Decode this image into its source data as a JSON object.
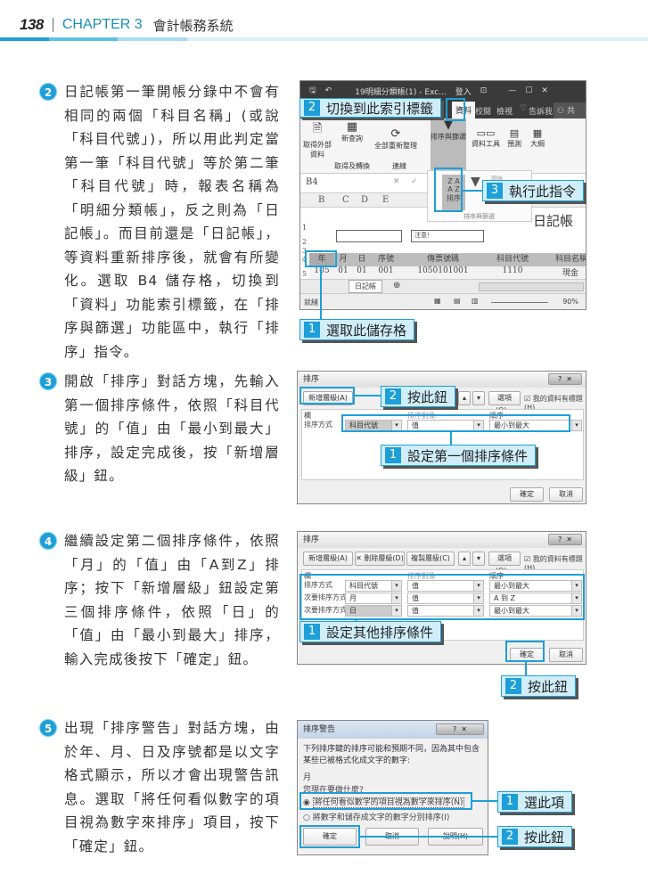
{
  "header": {
    "page_number": "138",
    "chapter": "CHAPTER 3",
    "chapter_title": "會計帳務系統"
  },
  "steps": [
    {
      "num": "2",
      "text": "日記帳第一筆開帳分錄中不會有相同的兩個「科目名稱」(或說「科目代號」)，所以用此判定當第一筆「科目代號」等於第二筆「科目代號」時，報表名稱為「明細分類帳」，反之則為「日記帳」。而目前還是「日記帳」，等資料重新排序後，就會有所變化。選取 B4 儲存格，切換到「資料」功能索引標籤，在「排序與篩選」功能區中，執行「排序」指令。"
    },
    {
      "num": "3",
      "text": "開啟「排序」對話方塊，先輸入第一個排序條件，依照「科目代號」的「值」由「最小到最大」排序，設定完成後，按「新增層級」鈕。"
    },
    {
      "num": "4",
      "text": "繼續設定第二個排序條件，依照「月」的「值」由「A到Z」排序；按下「新增層級」鈕設定第三個排序條件，依照「日」的「值」由「最小到最大」排序，輸入完成後按下「確定」鈕。"
    },
    {
      "num": "5",
      "text": "出現「排序警告」對話方塊，由於年、月、日及序號都是以文字格式顯示，所以才會出現警告訊息。選取「將任何看似數字的項目視為數字來排序」項目，按下「確定」鈕。"
    }
  ],
  "excel": {
    "window_title": "19明細分類帳(1) - Exc...",
    "signin": "登入",
    "tabs": [
      "公式",
      "資料",
      "校閱",
      "檢視"
    ],
    "tell_me": "告訴我",
    "share": "共用",
    "ribbon": {
      "get_external": "取得外部資料",
      "new_query": "新查詢",
      "group1": "取得及轉換",
      "refresh_all": "全部重新整理",
      "group2": "連線",
      "sort_filter": "排序與篩選",
      "data_tools": "資料工具",
      "forecast": "預測",
      "outline": "大綱",
      "sort": "排序",
      "filter": "篩選",
      "clear": "清除",
      "group3": "排序與篩選"
    },
    "name_box": "B4",
    "columns": [
      "B",
      "C",
      "D",
      "E"
    ],
    "sheet_title": "日記帳",
    "note": "注意！",
    "table_headers": [
      "年",
      "月",
      "日",
      "序號",
      "傳票號碼",
      "科目代號",
      "科目名稱"
    ],
    "row5": [
      "105",
      "01",
      "01",
      "001",
      "1050101001",
      "1110",
      "現金"
    ],
    "row_numbers": [
      "1",
      "2",
      "3",
      "4",
      "5"
    ],
    "sheet_tab": "日記帳",
    "status": "就緒",
    "zoom": "90%"
  },
  "sort_dialog1": {
    "title": "排序",
    "add_level": "新增層級(A)",
    "options": "選項(O)...",
    "has_headers": "我的資料有標題(H)",
    "col_header": "欄",
    "sort_on_header": "排序對象",
    "order_header": "順序",
    "rows": [
      {
        "label": "排序方式",
        "column": "科目代號",
        "sort_on": "值",
        "order": "最小到最大"
      }
    ],
    "ok": "確定",
    "cancel": "取消"
  },
  "sort_dialog2": {
    "title": "排序",
    "add_level": "新增層級(A)",
    "delete_level": "刪除層級(D)",
    "copy_level": "複製層級(C)",
    "options": "選項(O)...",
    "has_headers": "我的資料有標題(H)",
    "col_header": "欄",
    "sort_on_header": "排序對象",
    "order_header": "順序",
    "rows": [
      {
        "label": "排序方式",
        "column": "科目代號",
        "sort_on": "值",
        "order": "最小到最大"
      },
      {
        "label": "次要排序方式",
        "column": "月",
        "sort_on": "值",
        "order": "A 到 Z"
      },
      {
        "label": "次要排序方式",
        "column": "日",
        "sort_on": "值",
        "order": "最小到最大"
      }
    ],
    "ok": "確定",
    "cancel": "取消"
  },
  "warning_dialog": {
    "title": "排序警告",
    "message": "下列排序鍵的排序可能和預期不同，因為其中包含某些已被格式化成文字的數字:",
    "key": "月",
    "question": "您現在要做什麼?",
    "option1": "將任何看似數字的項目視為數字來排序(N)",
    "option2": "將數字和儲存成文字的數字分別排序(I)",
    "ok": "確定",
    "cancel": "取消",
    "help": "說明(H)"
  },
  "callouts": {
    "c1_switch_tab": {
      "num": "2",
      "text": "切換到此索引標籤"
    },
    "c1_run_cmd": {
      "num": "3",
      "text": "執行此指令"
    },
    "c1_select_cell": {
      "num": "1",
      "text": "選取此儲存格"
    },
    "c2_press": {
      "num": "2",
      "text": "按此鈕"
    },
    "c2_set_first": {
      "num": "1",
      "text": "設定第一個排序條件"
    },
    "c3_set_other": {
      "num": "1",
      "text": "設定其他排序條件"
    },
    "c3_press": {
      "num": "2",
      "text": "按此鈕"
    },
    "c4_select": {
      "num": "1",
      "text": "選此項"
    },
    "c4_press": {
      "num": "2",
      "text": "按此鈕"
    }
  }
}
